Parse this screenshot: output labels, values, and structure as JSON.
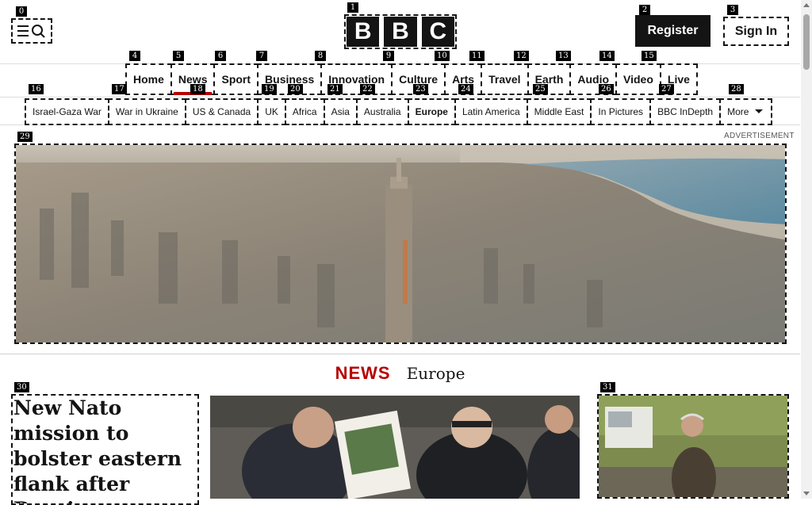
{
  "header": {
    "logo_letters": [
      "B",
      "B",
      "C"
    ],
    "register_label": "Register",
    "signin_label": "Sign In"
  },
  "nav": {
    "items": [
      "Home",
      "News",
      "Sport",
      "Business",
      "Innovation",
      "Culture",
      "Arts",
      "Travel",
      "Earth",
      "Audio",
      "Video",
      "Live"
    ],
    "active": "News"
  },
  "subnav": {
    "items": [
      "Israel-Gaza War",
      "War in Ukraine",
      "US & Canada",
      "UK",
      "Africa",
      "Asia",
      "Australia",
      "Europe",
      "Latin America",
      "Middle East",
      "In Pictures",
      "BBC InDepth",
      "More"
    ],
    "active": "Europe"
  },
  "ad": {
    "label": "ADVERTISEMENT"
  },
  "section": {
    "brand": "NEWS",
    "name": "Europe"
  },
  "lead_story": {
    "headline": "New Nato mission to bolster eastern flank after Russia"
  },
  "badges": [
    "0",
    "1",
    "2",
    "3",
    "4",
    "5",
    "6",
    "7",
    "8",
    "9",
    "10",
    "11",
    "12",
    "13",
    "14",
    "15",
    "16",
    "17",
    "18",
    "19",
    "20",
    "21",
    "22",
    "23",
    "24",
    "25",
    "26",
    "27",
    "28",
    "29",
    "30",
    "31"
  ],
  "colors": {
    "accent": "#b80000",
    "brand_dark": "#141414"
  }
}
